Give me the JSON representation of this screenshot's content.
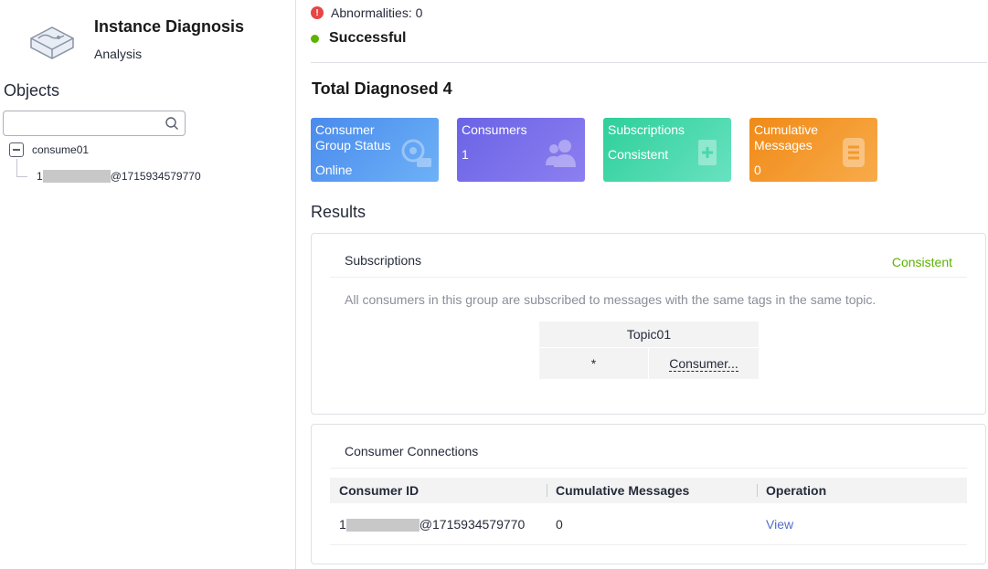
{
  "app": {
    "title": "Instance Diagnosis",
    "subtitle": "Analysis"
  },
  "sidebar": {
    "objects_label": "Objects",
    "search": {
      "value": "",
      "placeholder": ""
    },
    "tree": {
      "group": "consume01",
      "child_prefix": "1",
      "child_suffix": "@1715934579770"
    }
  },
  "status": {
    "abnormalities": "Abnormalities: 0",
    "result": "Successful"
  },
  "summary": {
    "total": "Total Diagnosed 4",
    "cards": [
      {
        "title": "Consumer Group Status",
        "value": "Online",
        "icon": "gears-icon",
        "color": "#4a8bec"
      },
      {
        "title": "Consumers",
        "value": "1",
        "icon": "users-icon",
        "color": "#6a63e5"
      },
      {
        "title": "Subscriptions",
        "value": "Consistent",
        "icon": "doc-add-icon",
        "color": "#2ecf9a"
      },
      {
        "title": "Cumulative Messages",
        "value": "0",
        "icon": "list-icon",
        "color": "#f08a17"
      }
    ]
  },
  "results": {
    "label": "Results",
    "subscriptions": {
      "title": "Subscriptions",
      "status": "Consistent",
      "description": "All consumers in this group are subscribed to messages with the same tags in the same topic.",
      "topic_header": "Topic01",
      "row": {
        "tag": "*",
        "consumer": "Consumer..."
      }
    },
    "connections": {
      "title": "Consumer Connections",
      "columns": [
        "Consumer ID",
        "Cumulative Messages",
        "Operation"
      ],
      "rows": [
        {
          "id_prefix": "1",
          "id_suffix": "@1715934579770",
          "messages": "0",
          "operation": "View"
        }
      ]
    }
  },
  "colors": {
    "success": "#5cb300",
    "error": "#e84545",
    "link": "#526ecc"
  }
}
